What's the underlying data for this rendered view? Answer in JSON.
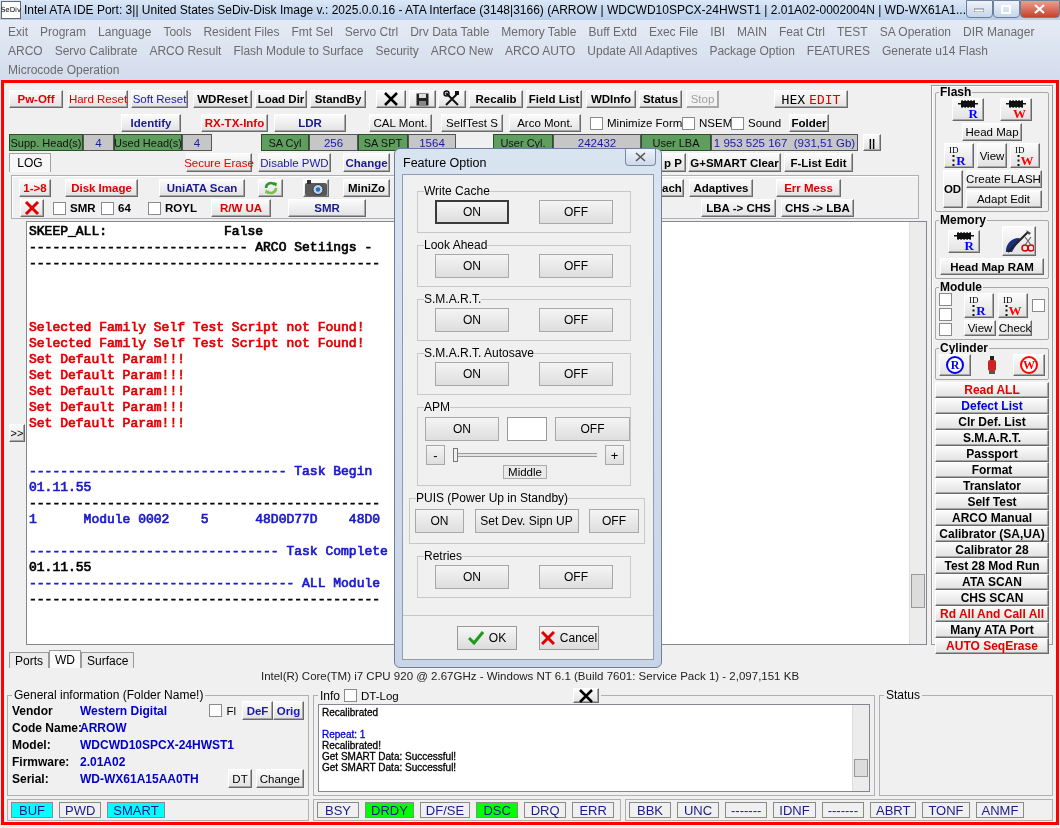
{
  "window": {
    "icon_text": "SeDiv",
    "title": "Intel ATA IDE  Port: 3|| United States  SeDiv-Disk Image v.: 2025.0.0.16 - ATA Interface (3148|3166)  (ARROW | WDCWD10SPCX-24HWST1 | 2.01A02-0002004N | WD-WX61A1..."
  },
  "menu": {
    "lines": [
      {
        "items": [
          "Exit",
          "Program",
          "Language",
          "Tools",
          "Resident Files",
          "Fmt Sel",
          "Servo Ctrl",
          "Drv Data Table",
          "Memory Table",
          "Buff Extd",
          "Exec File",
          "IBI",
          "MAIN",
          "Feat Ctrl",
          "TEST",
          "SA Operation",
          "DIR Manager"
        ]
      },
      {
        "items": [
          "ARCO",
          "Servo Calibrate",
          "ARCO Result",
          "Flash Module to Surface",
          "Security",
          "ARCO New",
          "ARCO AUTO",
          "Update All Adaptives",
          "Package Option",
          "FEATURES",
          "Generate u14 Flash"
        ]
      },
      {
        "items": [
          "Microcode Operation"
        ]
      }
    ]
  },
  "toolbar": {
    "rows": [
      {
        "items": [
          {
            "kind": "button",
            "label": "Pw-Off",
            "color": "#e00000",
            "bold": true,
            "disabled": false
          },
          {
            "kind": "button",
            "label": "Hard Reset",
            "color": "#e00000",
            "bold": false,
            "disabled": false
          },
          {
            "kind": "button",
            "label": "Soft Reset",
            "color": "#1a1a9c",
            "bold": false,
            "disabled": false
          },
          {
            "kind": "button",
            "label": "WDReset",
            "color": "#000000",
            "bold": true,
            "disabled": false
          },
          {
            "kind": "button",
            "label": "Load Dir",
            "color": "#000000",
            "bold": true,
            "disabled": false
          },
          {
            "kind": "button",
            "label": "StandBy",
            "color": "#000000",
            "bold": true,
            "disabled": false
          },
          {
            "kind": "icon"
          },
          {
            "kind": "icon"
          },
          {
            "kind": "icon"
          },
          {
            "kind": "button",
            "label": "Recalib",
            "color": "#000000",
            "bold": true,
            "disabled": false
          },
          {
            "kind": "button",
            "label": "Field List",
            "color": "#000000",
            "bold": true,
            "disabled": false
          },
          {
            "kind": "button",
            "label": "WDInfo",
            "color": "#000000",
            "bold": true,
            "disabled": false
          },
          {
            "kind": "button",
            "label": "Status",
            "color": "#000000",
            "bold": true,
            "disabled": false
          },
          {
            "kind": "button",
            "label": "Stop",
            "color": "#a0a0a0",
            "bold": false,
            "disabled": true
          },
          {
            "kind": "hex",
            "parts": [
              {
                "text": "HEX",
                "color": "#000000"
              },
              {
                "text": "EDIT",
                "color": "#e00000"
              }
            ]
          }
        ]
      },
      {
        "items": [
          {
            "kind": "button",
            "label": "Identify",
            "color": "#1a1a8c",
            "bold": true
          },
          {
            "kind": "button",
            "label": "RX-TX-Info",
            "color": "#e00000",
            "bold": true
          },
          {
            "kind": "button",
            "label": "LDR",
            "color": "#1a1a8c",
            "bold": true
          },
          {
            "kind": "button",
            "label": "CAL Mont.",
            "color": "#000000",
            "bold": false
          },
          {
            "kind": "button",
            "label": "SelfTest S",
            "color": "#000000",
            "bold": false
          },
          {
            "kind": "button",
            "label": "Arco Mont.",
            "color": "#000000",
            "bold": false
          },
          {
            "kind": "checkbox",
            "label": "Minimize Form",
            "checked": false,
            "bold": false
          },
          {
            "kind": "checkbox",
            "label": "NSEM",
            "checked": false,
            "bold": false
          },
          {
            "kind": "checkbox",
            "label": "Sound",
            "checked": false,
            "bold": false
          },
          {
            "kind": "button",
            "label": "Folder",
            "color": "#000000",
            "bold": true
          }
        ]
      },
      {
        "items": [
          {
            "kind": "tab",
            "label": "LOG",
            "selected": true
          },
          {
            "kind": "button",
            "label": "Secure Erase",
            "color": "#e00000",
            "bold": false
          },
          {
            "kind": "button",
            "label": "Disable PWD",
            "color": "#1a1a9c",
            "bold": false
          },
          {
            "kind": "button",
            "label": "Change",
            "color": "#1a1a8c",
            "bold": true
          },
          {
            "kind": "button",
            "label": "p P",
            "color": "#000000",
            "bold": true
          },
          {
            "kind": "button",
            "label": "G+SMART Clear",
            "color": "#000000",
            "bold": true
          },
          {
            "kind": "button",
            "label": "F-List Edit",
            "color": "#000000",
            "bold": true
          }
        ]
      },
      {
        "items": [
          {
            "kind": "button",
            "label": "1->8",
            "color": "#e00000",
            "bold": true
          },
          {
            "kind": "button",
            "label": "Disk Image",
            "color": "#e00000",
            "bold": true
          },
          {
            "kind": "button",
            "label": "UniATA Scan",
            "color": "#1a1a8c",
            "bold": true
          },
          {
            "kind": "icon"
          },
          {
            "kind": "icon"
          },
          {
            "kind": "button",
            "label": "MiniZo",
            "color": "#000000",
            "bold": true
          },
          {
            "kind": "button",
            "label": "ach",
            "color": "#000000",
            "bold": true
          },
          {
            "kind": "button",
            "label": "Adaptives",
            "color": "#000000",
            "bold": true
          },
          {
            "kind": "button",
            "label": "Err Mess",
            "color": "#e00000",
            "bold": true
          }
        ]
      },
      {
        "items": [
          {
            "kind": "icon"
          },
          {
            "kind": "checkbox",
            "label": "SMR",
            "checked": false,
            "bold": true
          },
          {
            "kind": "checkbox",
            "label": "64",
            "checked": false,
            "bold": true
          },
          {
            "kind": "checkbox",
            "label": "ROYL",
            "checked": false,
            "bold": true
          },
          {
            "kind": "button",
            "label": "R/W UA",
            "color": "#e00000",
            "bold": true
          },
          {
            "kind": "button",
            "label": "SMR",
            "color": "#1a1a8c",
            "bold": true
          },
          {
            "kind": "button",
            "label": "LBA -> CHS",
            "color": "#000000",
            "bold": true
          },
          {
            "kind": "button",
            "label": "CHS -> LBA",
            "color": "#000000",
            "bold": true
          }
        ]
      }
    ]
  },
  "drive_info": {
    "fields": [
      {
        "label": "Supp. Head(s)",
        "value": "4"
      },
      {
        "label": "Used Head(s)",
        "value": "4"
      },
      {
        "label": "SA Cyl",
        "value": "256"
      },
      {
        "label": "SA SPT",
        "value": "1564"
      },
      {
        "label": "User Cyl.",
        "value": "242432"
      },
      {
        "label": "User LBA",
        "value": "1 953 525 167  (931,51 Gb)"
      }
    ],
    "pause_button": "||"
  },
  "log": {
    "expand_button": ">>",
    "lines": [
      {
        "kind": "text",
        "text": "SKEEP_ALL:               False",
        "color": "#000000"
      },
      {
        "kind": "text",
        "text": "---------------------------- ARCO Setiings -",
        "color": "#000000"
      },
      {
        "kind": "text",
        "text": "---------------------------------------------",
        "color": "#000000"
      },
      {
        "kind": "blank"
      },
      {
        "kind": "blank"
      },
      {
        "kind": "blank"
      },
      {
        "kind": "text",
        "text": "Selected Family Self Test Script not Found!",
        "color": "#e00000"
      },
      {
        "kind": "text",
        "text": "Selected Family Self Test Script not Found!",
        "color": "#e00000"
      },
      {
        "kind": "text",
        "text": "Set Default Param!!!",
        "color": "#e00000"
      },
      {
        "kind": "text",
        "text": "Set Default Param!!!",
        "color": "#e00000"
      },
      {
        "kind": "text",
        "text": "Set Default Param!!!",
        "color": "#e00000"
      },
      {
        "kind": "text",
        "text": "Set Default Param!!!",
        "color": "#e00000"
      },
      {
        "kind": "text",
        "text": "Set Default Param!!!",
        "color": "#e00000"
      },
      {
        "kind": "blank"
      },
      {
        "kind": "blank"
      },
      {
        "kind": "text",
        "text": "--------------------------------- Task Begin",
        "color": "#1a1acc"
      },
      {
        "kind": "text",
        "text": "01.11.55",
        "color": "#1a1acc"
      },
      {
        "kind": "text",
        "text": "---------------------------------------------",
        "color": "#000000"
      },
      {
        "kind": "text",
        "text": "1      Module 0002    5      48D0D77D    48D0",
        "color": "#1a1acc"
      },
      {
        "kind": "blank"
      },
      {
        "kind": "text",
        "text": "-------------------------------- Task Complete",
        "color": "#1a1acc"
      },
      {
        "kind": "text",
        "text": "01.11.55",
        "color": "#000000"
      },
      {
        "kind": "text",
        "text": "---------------------------------- ALL Module",
        "color": "#1a1acc"
      },
      {
        "kind": "text",
        "text": "---------------------------------------------",
        "color": "#000000"
      }
    ]
  },
  "right_panel": {
    "flash": {
      "title": "Flash",
      "chip_buttons": [
        {
          "letter": "R",
          "color": "#0000ff"
        },
        {
          "letter": "W",
          "color": "#ff0000"
        }
      ],
      "head_map": "Head Map",
      "id_buttons": [
        {
          "tag": "ID",
          "letter": "R",
          "color": "#0000ff"
        },
        {
          "tag": "ID",
          "letter": "W",
          "color": "#ff0000"
        }
      ],
      "view": "View",
      "od": "OD",
      "create_flash": "Create FLASH",
      "adapt_edit": "Adapt Edit"
    },
    "memory": {
      "title": "Memory",
      "chip_button": {
        "letter": "R",
        "color": "#0000ff"
      },
      "head_map_ram": "Head Map RAM"
    },
    "module": {
      "title": "Module",
      "checkboxes": [
        {
          "checked": false
        },
        {
          "checked": false
        },
        {
          "checked": false
        },
        {
          "checked": false
        }
      ],
      "id_buttons": [
        {
          "tag": "ID",
          "letter": "R",
          "color": "#0000ff"
        },
        {
          "tag": "ID",
          "letter": "W",
          "color": "#ff0000"
        }
      ],
      "view": "View",
      "check": "Check"
    },
    "cylinder": {
      "title": "Cylinder",
      "buttons": [
        {
          "letter": "R",
          "color": "#0000ff"
        },
        {
          "letter": "W",
          "color": "#ff0000"
        }
      ]
    },
    "actions": [
      {
        "label": "Read ALL",
        "color": "#e00000"
      },
      {
        "label": "Defect List",
        "color": "#0000dd"
      },
      {
        "label": "Clr Def. List",
        "color": "#000000"
      },
      {
        "label": "S.M.A.R.T.",
        "color": "#000000"
      },
      {
        "label": "Passport",
        "color": "#000000"
      },
      {
        "label": "Format",
        "color": "#000000"
      },
      {
        "label": "Translator",
        "color": "#000000"
      },
      {
        "label": "Self Test",
        "color": "#000000"
      },
      {
        "label": "ARCO Manual",
        "color": "#000000"
      },
      {
        "label": "Calibrator (SA,UA)",
        "color": "#000000"
      },
      {
        "label": "Calibrator 28",
        "color": "#000000"
      },
      {
        "label": "Test 28 Mod Run",
        "color": "#000000"
      },
      {
        "label": "ATA SCAN",
        "color": "#000000"
      },
      {
        "label": "CHS SCAN",
        "color": "#000000"
      },
      {
        "label": "Rd All And Call All",
        "color": "#e00000"
      },
      {
        "label": "Many ATA Port",
        "color": "#000000"
      }
    ],
    "auto_button": {
      "label": "AUTO SeqErase",
      "color": "#e00000"
    }
  },
  "tabs": [
    {
      "label": "Ports",
      "selected": false
    },
    {
      "label": "WD",
      "selected": true
    },
    {
      "label": "Surface",
      "selected": false
    }
  ],
  "system_info": "Intel(R) Core(TM) i7 CPU 920  @ 2.67GHz - Windows NT 6.1 (Build 7601: Service Pack 1) -  2,097,151 KB",
  "general_info": {
    "title": "General information (Folder Name!)",
    "fields": [
      {
        "label": "Vendor",
        "value": "Western Digital"
      },
      {
        "label": "Code Name:",
        "value": "ARROW"
      },
      {
        "label": "Model:",
        "value": "WDCWD10SPCX-24HWST1"
      },
      {
        "label": "Firmware:",
        "value": "2.01A02"
      },
      {
        "label": "Serial:",
        "value": "WD-WX61A15AA0TH"
      }
    ],
    "checkbox": {
      "label": "Fl",
      "checked": false
    },
    "buttons_top": [
      "DeF",
      "Orig"
    ],
    "buttons_bottom": [
      "DT",
      "Change"
    ]
  },
  "info": {
    "title": "Info",
    "checkbox": {
      "label": "DT-Log",
      "checked": false
    },
    "lines": [
      {
        "kind": "text",
        "text": "Recalibrated",
        "color": "#000000"
      },
      {
        "kind": "blank"
      },
      {
        "kind": "text",
        "text": "Repeat: 1",
        "color": "#0000dd"
      },
      {
        "kind": "text",
        "text": "Recalibrated!",
        "color": "#000000"
      },
      {
        "kind": "text",
        "text": "Get SMART Data: Successful!",
        "color": "#000000"
      },
      {
        "kind": "text",
        "text": "Get SMART Data: Successful!",
        "color": "#000000"
      }
    ]
  },
  "status": {
    "title": "Status"
  },
  "indicators": [
    [
      {
        "label": "BUF",
        "color": "#00ffff"
      },
      {
        "label": "PWD",
        "color": "#f0f0f0"
      },
      {
        "label": "SMART",
        "color": "#00ffff"
      }
    ],
    [
      {
        "label": "BSY",
        "color": "#f0f0f0"
      },
      {
        "label": "DRDY",
        "color": "#00ff00"
      },
      {
        "label": "DF/SE",
        "color": "#f0f0f0"
      },
      {
        "label": "DSC",
        "color": "#00ff00"
      },
      {
        "label": "DRQ",
        "color": "#f0f0f0"
      },
      {
        "label": "ERR",
        "color": "#f0f0f0"
      }
    ],
    [
      {
        "label": "BBK",
        "color": "#f0f0f0"
      },
      {
        "label": "UNC",
        "color": "#f0f0f0"
      },
      {
        "label": "-------",
        "color": "#f0f0f0"
      },
      {
        "label": "IDNF",
        "color": "#f0f0f0"
      },
      {
        "label": "-------",
        "color": "#f0f0f0"
      },
      {
        "label": "ABRT",
        "color": "#f0f0f0"
      },
      {
        "label": "TONF",
        "color": "#f0f0f0"
      },
      {
        "label": "ANMF",
        "color": "#f0f0f0"
      }
    ]
  ],
  "dialog": {
    "title": "Feature Option",
    "groups": [
      {
        "kind": "toggle",
        "title": "Write Cache",
        "buttons": [
          {
            "label": "ON",
            "focused": true
          },
          {
            "label": "OFF",
            "focused": false
          }
        ]
      },
      {
        "kind": "toggle",
        "title": "Look Ahead",
        "buttons": [
          {
            "label": "ON",
            "focused": false
          },
          {
            "label": "OFF",
            "focused": false
          }
        ]
      },
      {
        "kind": "toggle",
        "title": "S.M.A.R.T.",
        "buttons": [
          {
            "label": "ON",
            "focused": false
          },
          {
            "label": "OFF",
            "focused": false
          }
        ]
      },
      {
        "kind": "toggle",
        "title": "S.M.A.R.T. Autosave",
        "buttons": [
          {
            "label": "ON",
            "focused": false
          },
          {
            "label": "OFF",
            "focused": false
          }
        ]
      },
      {
        "kind": "apm",
        "title": "APM",
        "buttons": [
          {
            "label": "ON",
            "focused": false
          },
          {
            "label": "OFF",
            "focused": false
          }
        ],
        "slider": {
          "minus": "-",
          "plus": "+",
          "caption": "Middle",
          "level": 0
        }
      },
      {
        "kind": "wide",
        "title": "PUIS (Power Up in Standby)",
        "buttons": [
          {
            "label": "ON",
            "focused": false
          },
          {
            "label": "Set Dev. Sipn UP",
            "focused": false
          },
          {
            "label": "OFF",
            "focused": false
          }
        ]
      },
      {
        "kind": "toggle",
        "title": "Retries",
        "buttons": [
          {
            "label": "ON",
            "focused": false
          },
          {
            "label": "OFF",
            "focused": false
          }
        ]
      }
    ],
    "ok": "OK",
    "cancel": "Cancel"
  }
}
